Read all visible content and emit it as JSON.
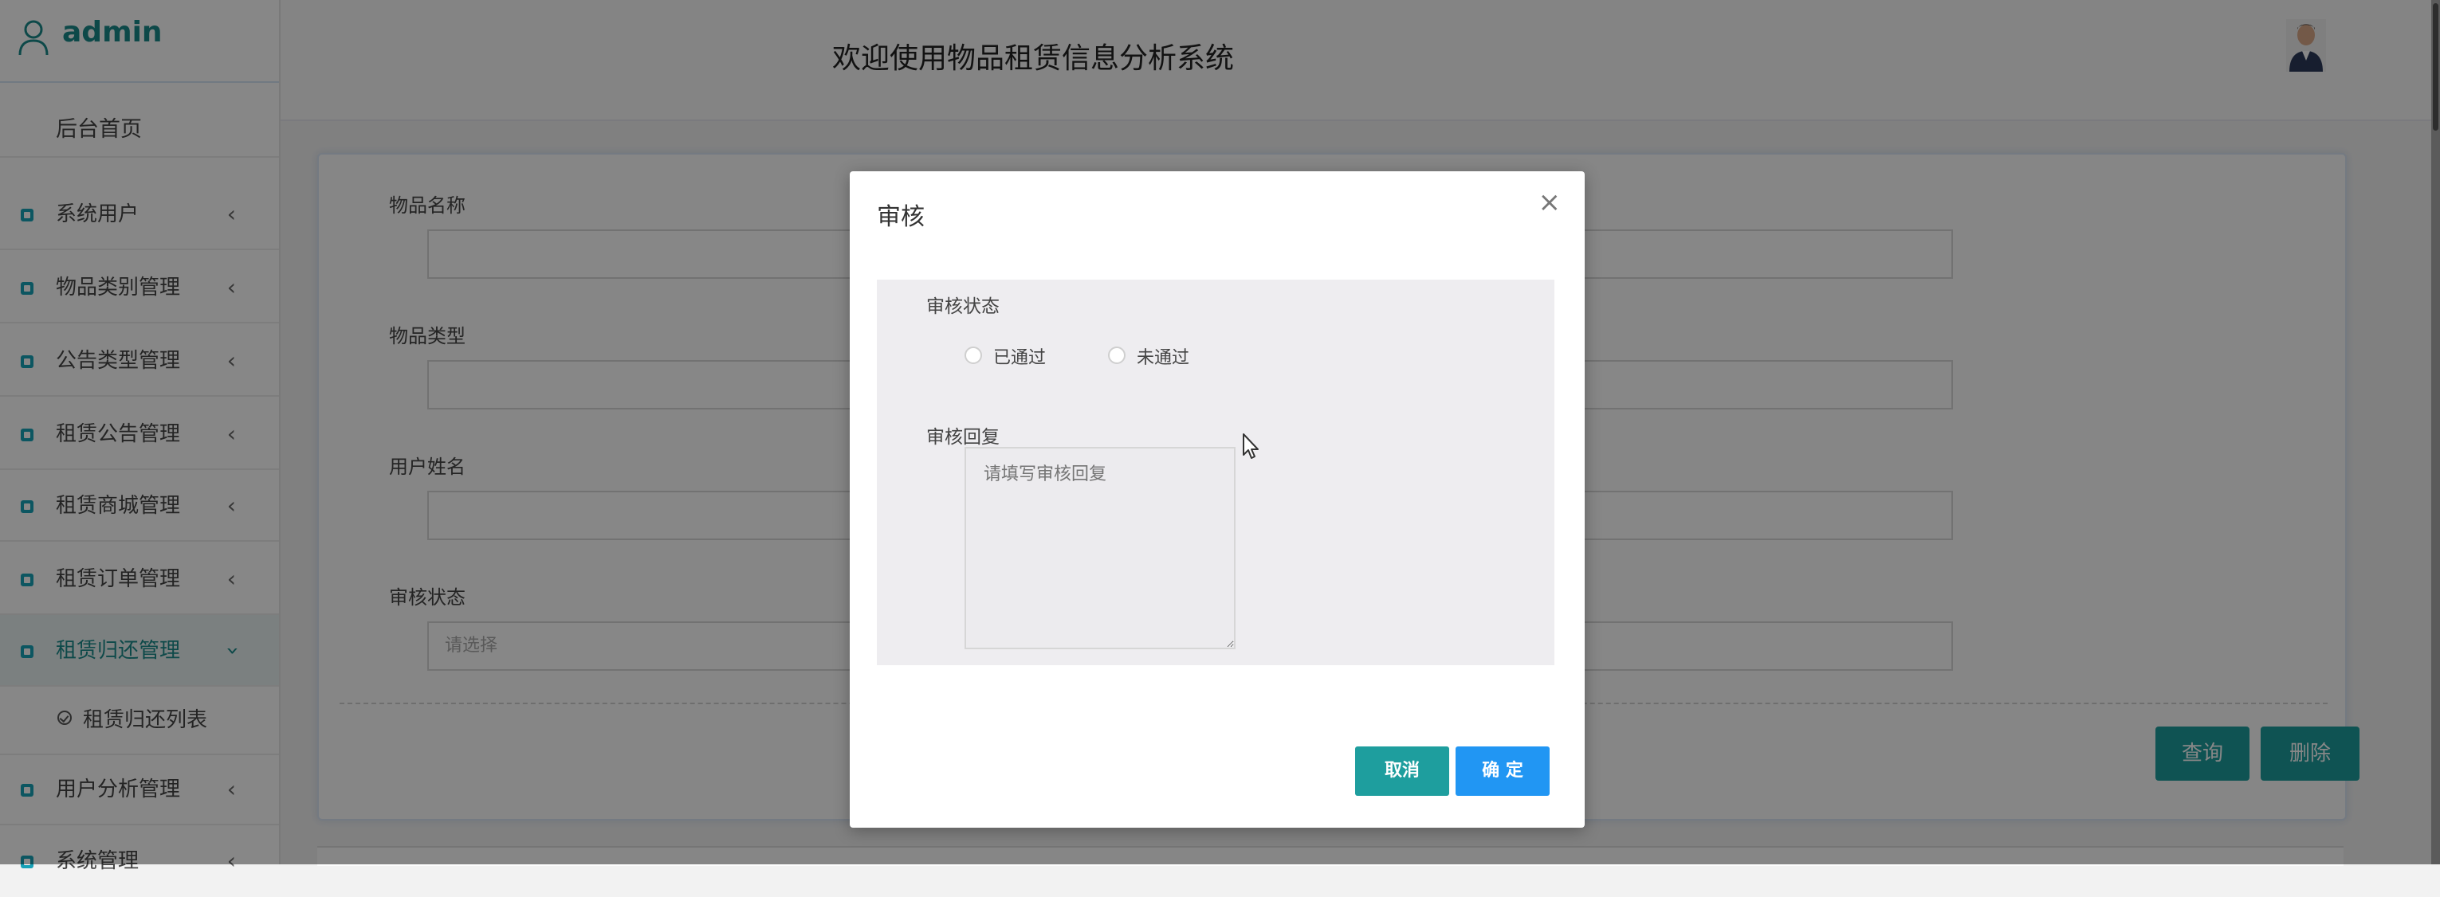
{
  "sidebar": {
    "brand": "admin",
    "home": "后台首页",
    "items": [
      {
        "label": "系统用户"
      },
      {
        "label": "物品类别管理"
      },
      {
        "label": "公告类型管理"
      },
      {
        "label": "租赁公告管理"
      },
      {
        "label": "租赁商城管理"
      },
      {
        "label": "租赁订单管理"
      },
      {
        "label": "租赁归还管理"
      },
      {
        "label": "用户分析管理"
      },
      {
        "label": "系统管理"
      }
    ],
    "submenu": {
      "label": "租赁归还列表"
    }
  },
  "header": {
    "title": "欢迎使用物品租赁信息分析系统"
  },
  "search_form": {
    "fields": [
      {
        "label": "物品名称",
        "value": ""
      },
      {
        "label": "物品类型",
        "value": ""
      },
      {
        "label": "用户姓名",
        "value": ""
      },
      {
        "label": "审核状态",
        "placeholder": "请选择"
      }
    ],
    "query_label": "查询",
    "delete_label": "删除"
  },
  "modal": {
    "title": "审核",
    "close": "×",
    "status_label": "审核状态",
    "options": [
      "已通过",
      "未通过"
    ],
    "reply_label": "审核回复",
    "reply_placeholder": "请填写审核回复",
    "cancel_label": "取消",
    "ok_label": "确 定"
  },
  "colors": {
    "accent": "#1a8a8a",
    "primary_blue": "#2196f3",
    "teal_button": "#1e9e9e"
  }
}
